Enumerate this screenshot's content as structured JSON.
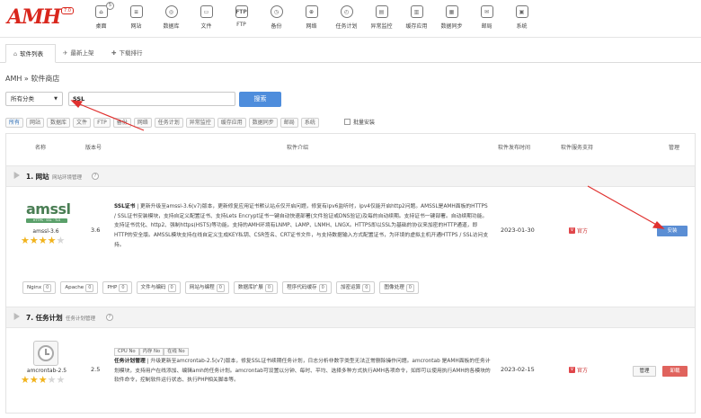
{
  "logo": {
    "text": "AMH",
    "version": "7.0"
  },
  "nav": [
    {
      "label": "桌面",
      "icon": "home-icon",
      "glyph": "⌂",
      "badge": "5"
    },
    {
      "label": "网站",
      "icon": "website-icon",
      "glyph": "≡"
    },
    {
      "label": "数据库",
      "icon": "database-icon",
      "glyph": "◎"
    },
    {
      "label": "文件",
      "icon": "folder-icon",
      "glyph": "▭"
    },
    {
      "label": "FTP",
      "icon": "ftp-icon",
      "glyph": "FTP"
    },
    {
      "label": "备份",
      "icon": "backup-icon",
      "glyph": "◷"
    },
    {
      "label": "网络",
      "icon": "network-icon",
      "glyph": "⊕"
    },
    {
      "label": "任务计划",
      "icon": "task-icon",
      "glyph": "◴"
    },
    {
      "label": "异常监控",
      "icon": "monitor-icon",
      "glyph": "▤"
    },
    {
      "label": "缓存应用",
      "icon": "cache-icon",
      "glyph": "▥"
    },
    {
      "label": "数据同步",
      "icon": "sync-icon",
      "glyph": "▦"
    },
    {
      "label": "邮局",
      "icon": "mail-icon",
      "glyph": "✉"
    },
    {
      "label": "系统",
      "icon": "system-icon",
      "glyph": "▣"
    }
  ],
  "tabs": [
    {
      "label": "软件列表",
      "icon": "home-icon",
      "glyph": "⌂",
      "active": true
    },
    {
      "label": "最新上架",
      "icon": "new-icon",
      "glyph": "✈",
      "active": false
    },
    {
      "label": "下载排行",
      "icon": "rank-icon",
      "glyph": "✚",
      "active": false
    }
  ],
  "breadcrumb": "AMH » 软件商店",
  "filter": {
    "category_value": "所有分类",
    "search_value": "SSL",
    "search_button": "搜索"
  },
  "categories": [
    "所有",
    "网站",
    "数据库",
    "文件",
    "FTP",
    "备份",
    "网络",
    "任务计划",
    "异常监控",
    "缓存应用",
    "数据同步",
    "邮局",
    "系统"
  ],
  "batch_label": "批量安装",
  "table_headers": {
    "name": "名称",
    "version": "版本号",
    "description": "软件介绍",
    "release_date": "软件发布时间",
    "support": "软件服务支持",
    "manage": "管理"
  },
  "sections": [
    {
      "title": "1. 网站",
      "subtitle": "网站环境管理",
      "help": "?"
    },
    {
      "title": "7. 任务计划",
      "subtitle": "任务计划管理",
      "help": "?"
    }
  ],
  "apps": [
    {
      "logo_text": "amssl",
      "logo_bar": "HTTPS · SSL · TLS",
      "name": "amssl-3.6",
      "rating": 4,
      "version": "3.6",
      "desc_title": "SSL证书",
      "description": "| 更新升级至amssl-3.6(v7)版本，更新修复应用证书默认站点仅开启问题，修复有ipv6监听时，ipv4仅能开启http2问题。AMSSL是AMH面板的HTTPS / SSL证书安装模块，支持自定义配置证书、支持Lets Encrypt证书一键自动快速部署(文件验证或DNS验证)及每的自动续期。支持证书一键部署。自动续期功能。支持证书优化、http2、强制https(HSTS)等功能。支持的AMH环境有LNMP、LAMP、LNMH、LNGX。HTTPS即以SSL为基础的协议来加密的HTTP通道，即HTTP的安全版。AMSSL模块支持在线自定义生成KEY私钥、CSR签名、CRT证书文件，与支持数据输入方式配置证书，为环境的虚拟主机开通HTTPS / SSL访问支持。",
      "date": "2023-01-30",
      "vendor": "官方",
      "install_label": "安装"
    },
    {
      "name": "amcrontab-2.5",
      "rating": 3,
      "version": "2.5",
      "tags": [
        "CPU No",
        "内存 No",
        "在线 No"
      ],
      "desc_title": "任务计划管理",
      "description": "| 升级更新至amcrontab-2.5(v7)版本，修复SSL证书续期任务计划，日志分析非数字类型无法正常删除操作问题。amcrontab 是AMH面板的任务计划模块，支持用户在线添加、编辑amh的任务计划。amcrontab可设置以分钟、每时、平均、选择多种方式执行AMH各项命令，如即可以使用执行AMH的各模块的软件命令，控制软件运行状态、执行PHP相关脚本等。",
      "date": "2023-02-15",
      "vendor": "官方",
      "manage_label": "管理",
      "uninstall_label": "卸载"
    }
  ],
  "module_chips": [
    {
      "label": "Nginx",
      "count": "0"
    },
    {
      "label": "Apache",
      "count": "0"
    },
    {
      "label": "PHP",
      "count": "0"
    },
    {
      "label": "文件与编码",
      "count": "0"
    },
    {
      "label": "网站与编程",
      "count": "0"
    },
    {
      "label": "数据库扩展",
      "count": "0"
    },
    {
      "label": "程序代码缓存",
      "count": "0"
    },
    {
      "label": "加密运算",
      "count": "0"
    },
    {
      "label": "图像处理",
      "count": "0"
    }
  ],
  "colors": {
    "brand": "#d9261c",
    "primary_button": "#4e8ddc",
    "uninstall_button": "#e0635d",
    "star": "#f1b31c",
    "annotation_arrow": "#e0312f"
  }
}
